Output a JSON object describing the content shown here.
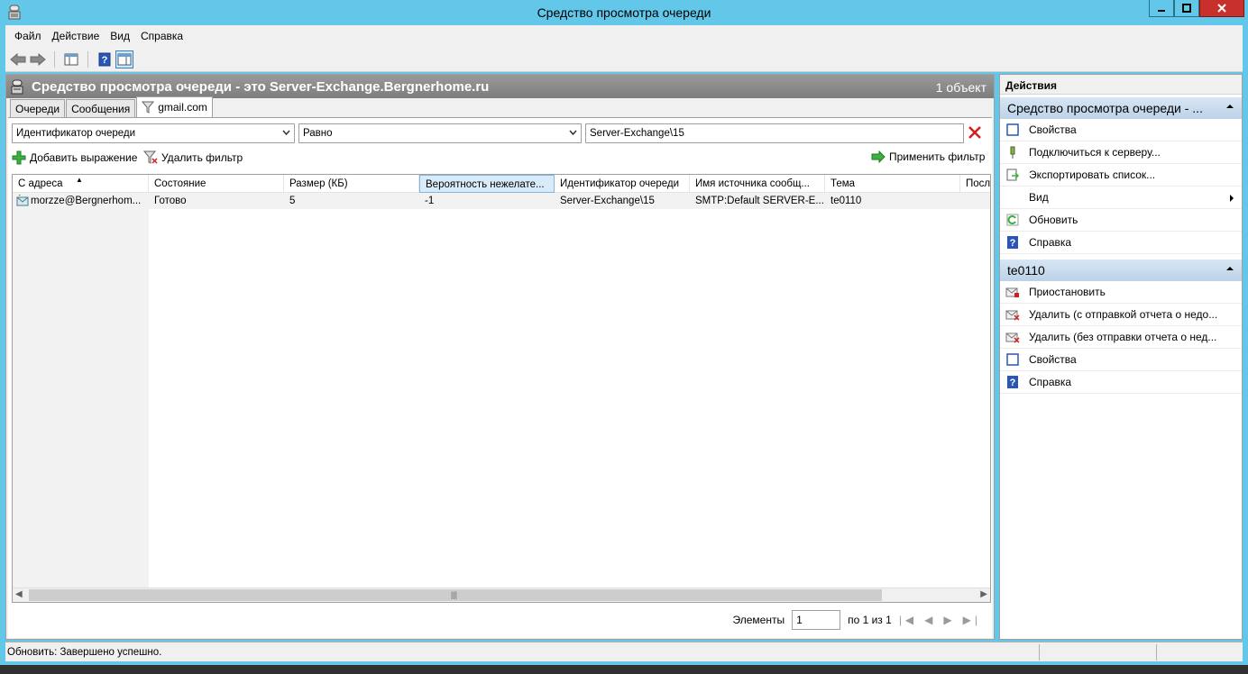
{
  "window": {
    "title": "Средство просмотра очереди"
  },
  "menu": [
    "Файл",
    "Действие",
    "Вид",
    "Справка"
  ],
  "main": {
    "header_title": "Средство просмотра очереди - это Server-Exchange.Bergnerhome.ru",
    "header_count": "1 объект",
    "tabs": [
      "Очереди",
      "Сообщения",
      "gmail.com"
    ],
    "filter": {
      "field": "Идентификатор очереди",
      "operator": "Равно",
      "value": "Server-Exchange\\15",
      "add_expression": "Добавить выражение",
      "remove_filter": "Удалить фильтр",
      "apply_filter": "Применить фильтр"
    },
    "columns": [
      "С адреса",
      "Состояние",
      "Размер (КБ)",
      "Вероятность нежелате...",
      "Идентификатор очереди",
      "Имя источника сообщ...",
      "Тема",
      "Посл"
    ],
    "rows": [
      [
        "morzze@Bergnerhom...",
        "Готово",
        "5",
        "-1",
        "Server-Exchange\\15",
        "SMTP:Default SERVER-E...",
        "te0110",
        ""
      ]
    ],
    "pager": {
      "label": "Элементы",
      "value": "1",
      "of": "по 1 из 1"
    }
  },
  "actions": {
    "title": "Действия",
    "section1": {
      "label": "Средство просмотра очереди - ...",
      "items": [
        "Свойства",
        "Подключиться к серверу...",
        "Экспортировать список...",
        "Вид",
        "Обновить",
        "Справка"
      ]
    },
    "section2": {
      "label": "te0110",
      "items": [
        "Приостановить",
        "Удалить (с отправкой отчета о недо...",
        "Удалить (без отправки отчета о нед...",
        "Свойства",
        "Справка"
      ]
    }
  },
  "status": {
    "text": "Обновить:  Завершено успешно."
  },
  "colors": {
    "titlebar": "#62c7e9",
    "close": "#c7302b",
    "header": "#8a8a8a",
    "section": "#c8dbee"
  }
}
